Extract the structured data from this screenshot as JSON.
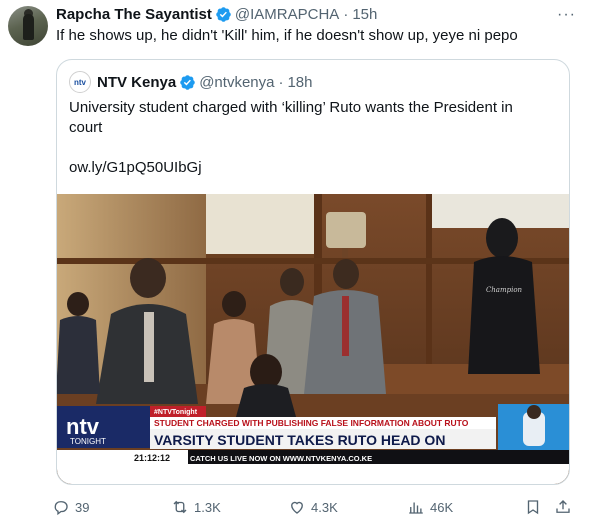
{
  "tweet": {
    "author_name": "Rapcha The Sayantist",
    "handle": "@IAMRAPCHA",
    "time": "15h",
    "text": "If he shows up, he didn't 'Kill' him, if he doesn't show up, yeye ni pepo"
  },
  "quoted": {
    "logo_text": "ntv",
    "author_name": "NTV Kenya",
    "handle": "@ntvkenya",
    "time": "18h",
    "text": "University student charged with ‘killing’ Ruto wants the President in court",
    "link": "ow.ly/G1pQ50UIbGj",
    "image": {
      "hoodie_text": "Champion",
      "tag": "#NTVTonight",
      "strap_small": "STUDENT CHARGED WITH PUBLISHING FALSE INFORMATION ABOUT RUTO",
      "strap_big": "VARSITY STUDENT TAKES RUTO HEAD ON",
      "channel_logo": "ntv",
      "channel_sub": "TONIGHT",
      "clock": "21:12:12",
      "ticker": "CATCH US LIVE NOW ON WWW.NTVKENYA.CO.KE"
    }
  },
  "stats": {
    "replies": "39",
    "reposts": "1.3K",
    "likes": "4.3K",
    "views": "46K"
  },
  "icons": [
    "verified-badge-icon",
    "more-icon",
    "reply-icon",
    "repost-icon",
    "like-icon",
    "views-icon",
    "bookmark-icon",
    "share-icon"
  ],
  "colors": {
    "accent": "#1d9bf0",
    "muted": "#536471",
    "border": "#cfd9de"
  }
}
